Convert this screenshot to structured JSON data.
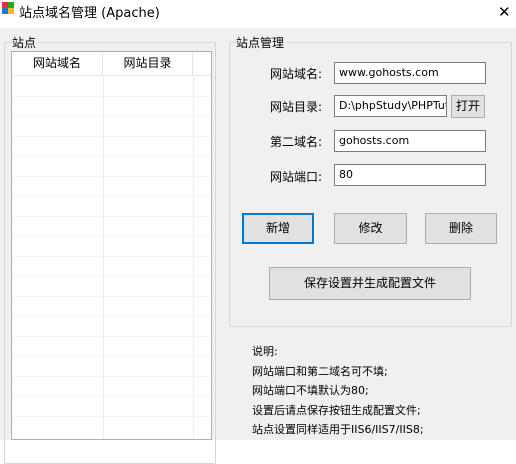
{
  "window": {
    "title": "站点域名管理 (Apache)",
    "close_symbol": "✕"
  },
  "site_group": {
    "label": "站点",
    "columns": [
      "网站域名",
      "网站目录"
    ]
  },
  "manage_group": {
    "label": "站点管理",
    "domain_label": "网站域名:",
    "domain_value": "www.gohosts.com",
    "dir_label": "网站目录:",
    "dir_value": "D:\\phpStudy\\PHPTutorial",
    "open_button": "打开",
    "second_domain_label": "第二域名:",
    "second_domain_value": "gohosts.com",
    "port_label": "网站端口:",
    "port_value": "80",
    "add_button": "新增",
    "edit_button": "修改",
    "delete_button": "删除",
    "save_button": "保存设置并生成配置文件"
  },
  "notes": {
    "title": "说明:",
    "line1": "网站端口和第二域名可不填;",
    "line2": "网站端口不填默认为80;",
    "line3": "设置后请点保存按钮生成配置文件;",
    "line4": "站点设置同样适用于IIS6/IIS7/IIS8;"
  }
}
